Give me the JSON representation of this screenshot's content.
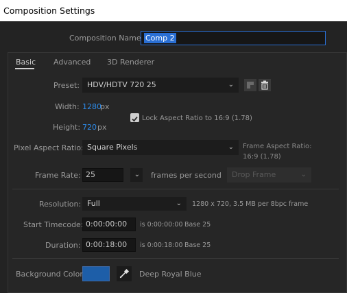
{
  "window": {
    "title": "Composition Settings"
  },
  "comp_name": {
    "label": "Composition Name:",
    "value": "Comp 2"
  },
  "tabs": [
    {
      "label": "Basic"
    },
    {
      "label": "Advanced"
    },
    {
      "label": "3D Renderer"
    }
  ],
  "preset": {
    "label": "Preset:",
    "value": "HDV/HDTV 720 25"
  },
  "width": {
    "label": "Width:",
    "value": "1280",
    "unit": "px"
  },
  "height": {
    "label": "Height:",
    "value": "720",
    "unit": "px"
  },
  "lock_aspect": {
    "label": "Lock Aspect Ratio to 16:9 (1.78)",
    "checked": true
  },
  "pixel_aspect": {
    "label": "Pixel Aspect Ratio:",
    "value": "Square Pixels"
  },
  "frame_aspect": {
    "label": "Frame Aspect Ratio:",
    "value": "16:9 (1.78)"
  },
  "frame_rate": {
    "label": "Frame Rate:",
    "value": "25",
    "unit": "frames per second",
    "drop_frame": "Drop Frame"
  },
  "resolution": {
    "label": "Resolution:",
    "value": "Full",
    "info": "1280 x 720, 3.5 MB per 8bpc frame"
  },
  "start_timecode": {
    "label": "Start Timecode:",
    "value": "0:00:00:00",
    "is": "is 0:00:00:00",
    "base": "Base 25"
  },
  "duration": {
    "label": "Duration:",
    "value": "0:00:18:00",
    "is": "is 0:00:18:00",
    "base": "Base 25"
  },
  "background": {
    "label": "Background Color:",
    "color": "#1d5ea8",
    "name": "Deep Royal Blue"
  },
  "colors": {
    "accent_blue": "#2d8ceb",
    "selection": "#2a6fd4"
  },
  "icons": {
    "save_preset": "save-icon",
    "delete_preset": "trash-icon",
    "eyedropper": "eyedropper-icon",
    "dropdown": "chevron-down-icon",
    "checkbox": "checkmark-icon"
  }
}
